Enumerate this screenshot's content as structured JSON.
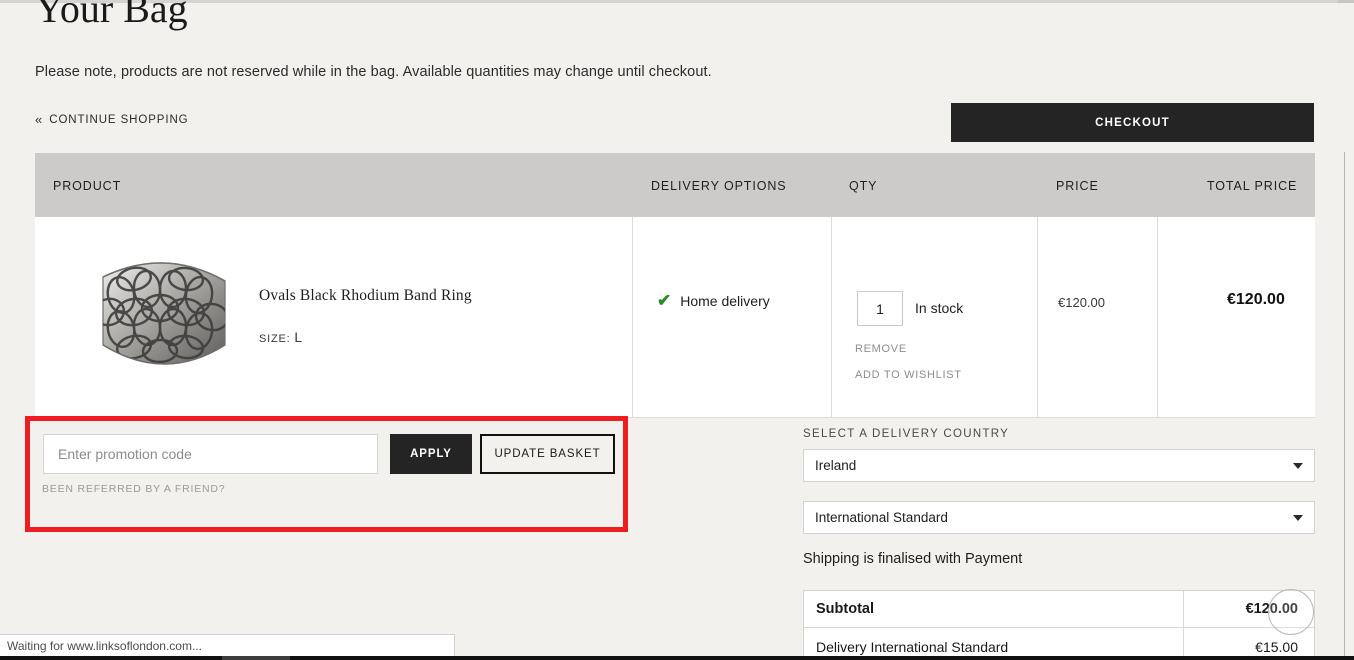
{
  "page": {
    "title": "Your Bag",
    "note": "Please note, products are not reserved while in the bag. Available quantities may change until checkout.",
    "continue_shopping": "CONTINUE SHOPPING",
    "continue_chevron": "«",
    "checkout_label": "CHECKOUT",
    "accent_red": "#ee1d22",
    "dark_button": "#242424",
    "header_grey": "#cccbc9",
    "background": "#f2f1ed"
  },
  "table": {
    "headers": {
      "product": "PRODUCT",
      "delivery_options": "DELIVERY OPTIONS",
      "qty": "QTY",
      "price": "PRICE",
      "total_price": "TOTAL PRICE"
    },
    "rows": [
      {
        "product_name": "Ovals Black Rhodium Band Ring",
        "size_label": "SIZE:",
        "size_value": "L",
        "image_alt": "silver lattice band ring",
        "delivery_option": "Home delivery",
        "delivery_icon": "green-check-icon",
        "qty_value": "1",
        "stock_status": "In stock",
        "remove_label": "REMOVE",
        "wishlist_label": "ADD TO WISHLIST",
        "price": "€120.00",
        "total_price": "€120.00"
      }
    ]
  },
  "promo": {
    "placeholder": "Enter promotion code",
    "value": "",
    "apply_label": "APPLY",
    "update_label": "UPDATE BASKET",
    "referred_label": "BEEN REFERRED BY A FRIEND?"
  },
  "delivery": {
    "select_label": "SELECT A DELIVERY COUNTRY",
    "country_value": "Ireland",
    "method_value": "International Standard",
    "shipping_note": "Shipping is finalised with Payment"
  },
  "totals": {
    "rows": [
      {
        "label": "Subtotal",
        "value": "€120.00",
        "bold": true
      },
      {
        "label": "Delivery International Standard",
        "value": "€15.00",
        "bold": false
      }
    ]
  },
  "browser": {
    "status_text": "Waiting for www.linksoflondon.com..."
  }
}
